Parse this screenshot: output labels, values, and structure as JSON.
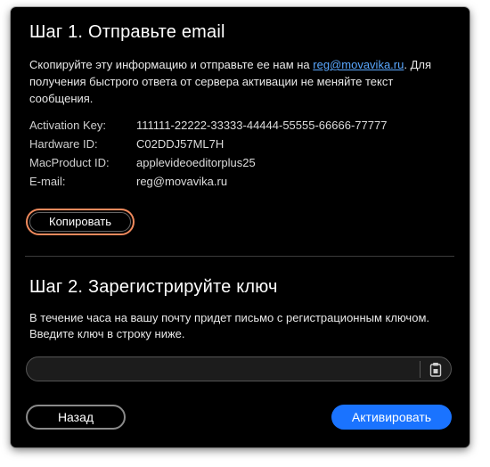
{
  "step1": {
    "title": "Шаг 1. Отправьте email",
    "text_before": "Скопируйте эту информацию и отправьте ее нам на ",
    "email_link": "reg@movavika.ru",
    "text_after": ". Для получения быстрого ответа от сервера активации не меняйте текст сообщения.",
    "fields": [
      {
        "label": "Activation Key:",
        "value": "111111-22222-33333-44444-55555-66666-77777"
      },
      {
        "label": "Hardware ID:",
        "value": "C02DDJ57ML7H"
      },
      {
        "label": "MacProduct ID:",
        "value": "applevideoeditorplus25"
      },
      {
        "label": "E-mail:",
        "value": "reg@movavika.ru"
      }
    ],
    "copy_label": "Копировать"
  },
  "step2": {
    "title": "Шаг 2. Зарегистрируйте ключ",
    "text": "В течение часа на вашу почту придет письмо с регистрационным ключом. Введите ключ в строку ниже.",
    "key_input_value": "",
    "key_input_placeholder": ""
  },
  "buttons": {
    "back_label": "Назад",
    "activate_label": "Активировать"
  },
  "colors": {
    "background": "#000000",
    "link": "#5aa8ff",
    "highlight": "#f08a5d",
    "primary": "#1a73ff"
  },
  "icons": {
    "paste": "clipboard-icon"
  }
}
